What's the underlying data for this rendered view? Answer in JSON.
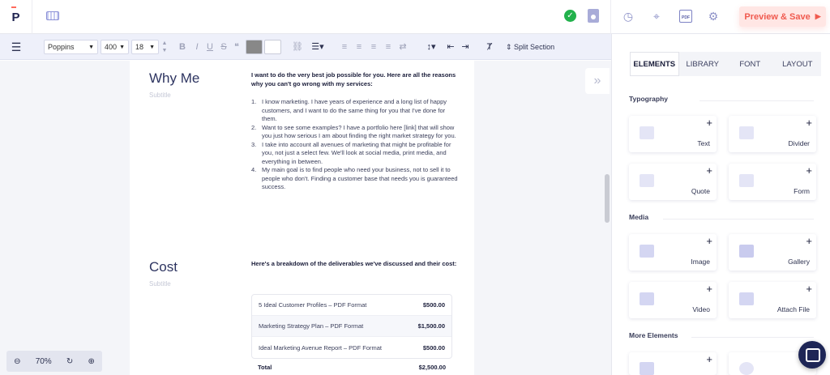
{
  "app": {
    "logo_text": "P"
  },
  "topbar": {
    "preview_save_label": "Preview & Save",
    "icons": [
      "keyboard-icon",
      "check-circle-icon",
      "save-icon",
      "history-icon",
      "target-icon",
      "pdf-icon",
      "gear-icon"
    ],
    "pdf_icon_text": "PDF"
  },
  "formatting": {
    "font_family": "Poppins",
    "font_weight": "400",
    "font_size": "18",
    "split_section_label": "Split Section",
    "bold": "B",
    "italic": "I",
    "underline": "U",
    "strike": "S",
    "quote": "❝",
    "text_color": "#888888",
    "bg_color": "#ffffff"
  },
  "document": {
    "sections": [
      {
        "title": "Why Me",
        "subtitle": "Subtitle",
        "intro": "I want to do the very best job possible for you. Here are all the reasons why you can't go wrong with my services:",
        "items": [
          "I know marketing. I have years of experience and a long list of happy customers, and I want to do the same thing for you that I've done for them.",
          "Want to see some examples? I have a portfolio here [link] that will show you just how serious I am about finding the right market strategy for you.",
          "I take into account all avenues of marketing that might be profitable for you, not just a select few. We'll look at social media, print media, and everything in between.",
          "My main goal is to find people who need your business, not to sell it to people who don't. Finding a customer base that needs you is guaranteed success."
        ]
      },
      {
        "title": "Cost",
        "subtitle": "Subtitle",
        "intro": "Here's a breakdown of the deliverables we've discussed and their cost:",
        "pricing": [
          {
            "item": "5 Ideal Customer Profiles – PDF Format",
            "amount": "$500.00"
          },
          {
            "item": "Marketing Strategy Plan – PDF Format",
            "amount": "$1,500.00"
          },
          {
            "item": "Ideal Marketing Avenue Report – PDF Format",
            "amount": "$500.00"
          }
        ],
        "total_label": "Total",
        "total_amount": "$2,500.00"
      }
    ]
  },
  "zoom": {
    "level": "70%"
  },
  "panel": {
    "tabs": [
      "ELEMENTS",
      "LIBRARY",
      "FONT",
      "LAYOUT"
    ],
    "active_tab": "ELEMENTS",
    "groups": {
      "typography": {
        "label": "Typography",
        "items": [
          "Text",
          "Divider",
          "Quote",
          "Form"
        ]
      },
      "media": {
        "label": "Media",
        "items": [
          "Image",
          "Gallery",
          "Video",
          "Attach File"
        ]
      },
      "more": {
        "label": "More Elements"
      }
    },
    "plus": "+"
  },
  "colors": {
    "accent": "#f05a4f",
    "brand": "#1e2656",
    "icon": "#8e92c8",
    "success": "#22b14c"
  }
}
